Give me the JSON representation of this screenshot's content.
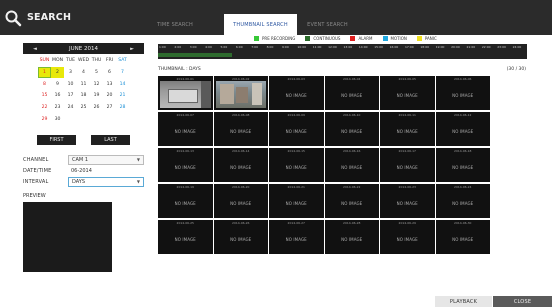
{
  "header": {
    "title": "SEARCH",
    "tabs": [
      {
        "label": "TIME SEARCH",
        "active": false
      },
      {
        "label": "THUMBNAIL SEARCH",
        "active": true
      },
      {
        "label": "EVENT SEARCH",
        "active": false
      }
    ]
  },
  "calendar": {
    "month_label": "JUNE 2014",
    "prev_arrow": "◄",
    "next_arrow": "►",
    "weekdays": [
      "SUN",
      "MON",
      "TUE",
      "WED",
      "THU",
      "FRI",
      "SAT"
    ],
    "weeks": [
      [
        "1",
        "2",
        "3",
        "4",
        "5",
        "6",
        "7"
      ],
      [
        "8",
        "9",
        "10",
        "11",
        "12",
        "13",
        "14"
      ],
      [
        "15",
        "16",
        "17",
        "18",
        "19",
        "20",
        "21"
      ],
      [
        "22",
        "23",
        "24",
        "25",
        "26",
        "27",
        "28"
      ],
      [
        "29",
        "30",
        "",
        "",
        "",
        "",
        ""
      ]
    ],
    "selected_day": "1",
    "recorded_days": [
      "1",
      "2"
    ]
  },
  "nav": {
    "first_label": "FIRST",
    "last_label": "LAST"
  },
  "form": {
    "channel_label": "CHANNEL",
    "channel_value": "CAM 1",
    "datetime_label": "DATE/TIME",
    "datetime_value": "06-2014",
    "interval_label": "INTERVAL",
    "interval_value": "DAYS"
  },
  "preview": {
    "label": "PREVIEW"
  },
  "legend": [
    {
      "label": "PRE RECORDING",
      "color": "#37c837"
    },
    {
      "label": "CONTINUOUS",
      "color": "#2a6a2a"
    },
    {
      "label": "ALARM",
      "color": "#e02020"
    },
    {
      "label": "MOTION",
      "color": "#20a8e0"
    },
    {
      "label": "PANIC",
      "color": "#f0e020"
    }
  ],
  "timeline": {
    "hours": [
      "1:00",
      "2:00",
      "3:00",
      "4:00",
      "5:00",
      "6:00",
      "7:00",
      "8:00",
      "9:00",
      "10:00",
      "11:00",
      "12:00",
      "13:00",
      "14:00",
      "15:00",
      "16:00",
      "17:00",
      "18:00",
      "19:00",
      "20:00",
      "21:00",
      "22:00",
      "23:00",
      "24:00"
    ],
    "recorded_fraction": 0.2
  },
  "thumbnail": {
    "header_label": "THUMBNAIL : DAYS",
    "page_count": "(30 / 30)",
    "no_image_label": "NO IMAGE",
    "items": [
      {
        "caption": "2014-06-01",
        "has_image": true
      },
      {
        "caption": "2014-06-02",
        "has_image": true
      },
      {
        "caption": "2014-06-03",
        "has_image": false
      },
      {
        "caption": "2014-06-04",
        "has_image": false
      },
      {
        "caption": "2014-06-05",
        "has_image": false
      },
      {
        "caption": "2014-06-06",
        "has_image": false
      },
      {
        "caption": "2014-06-07",
        "has_image": false
      },
      {
        "caption": "2014-06-08",
        "has_image": false
      },
      {
        "caption": "2014-06-09",
        "has_image": false
      },
      {
        "caption": "2014-06-10",
        "has_image": false
      },
      {
        "caption": "2014-06-11",
        "has_image": false
      },
      {
        "caption": "2014-06-12",
        "has_image": false
      },
      {
        "caption": "2014-06-13",
        "has_image": false
      },
      {
        "caption": "2014-06-14",
        "has_image": false
      },
      {
        "caption": "2014-06-15",
        "has_image": false
      },
      {
        "caption": "2014-06-16",
        "has_image": false
      },
      {
        "caption": "2014-06-17",
        "has_image": false
      },
      {
        "caption": "2014-06-18",
        "has_image": false
      },
      {
        "caption": "2014-06-19",
        "has_image": false
      },
      {
        "caption": "2014-06-20",
        "has_image": false
      },
      {
        "caption": "2014-06-21",
        "has_image": false
      },
      {
        "caption": "2014-06-22",
        "has_image": false
      },
      {
        "caption": "2014-06-23",
        "has_image": false
      },
      {
        "caption": "2014-06-24",
        "has_image": false
      },
      {
        "caption": "2014-06-25",
        "has_image": false
      },
      {
        "caption": "2014-06-26",
        "has_image": false
      },
      {
        "caption": "2014-06-27",
        "has_image": false
      },
      {
        "caption": "2014-06-28",
        "has_image": false
      },
      {
        "caption": "2014-06-29",
        "has_image": false
      },
      {
        "caption": "2014-06-30",
        "has_image": false
      }
    ]
  },
  "footer": {
    "playback_label": "PLAYBACK",
    "close_label": "CLOSE"
  }
}
